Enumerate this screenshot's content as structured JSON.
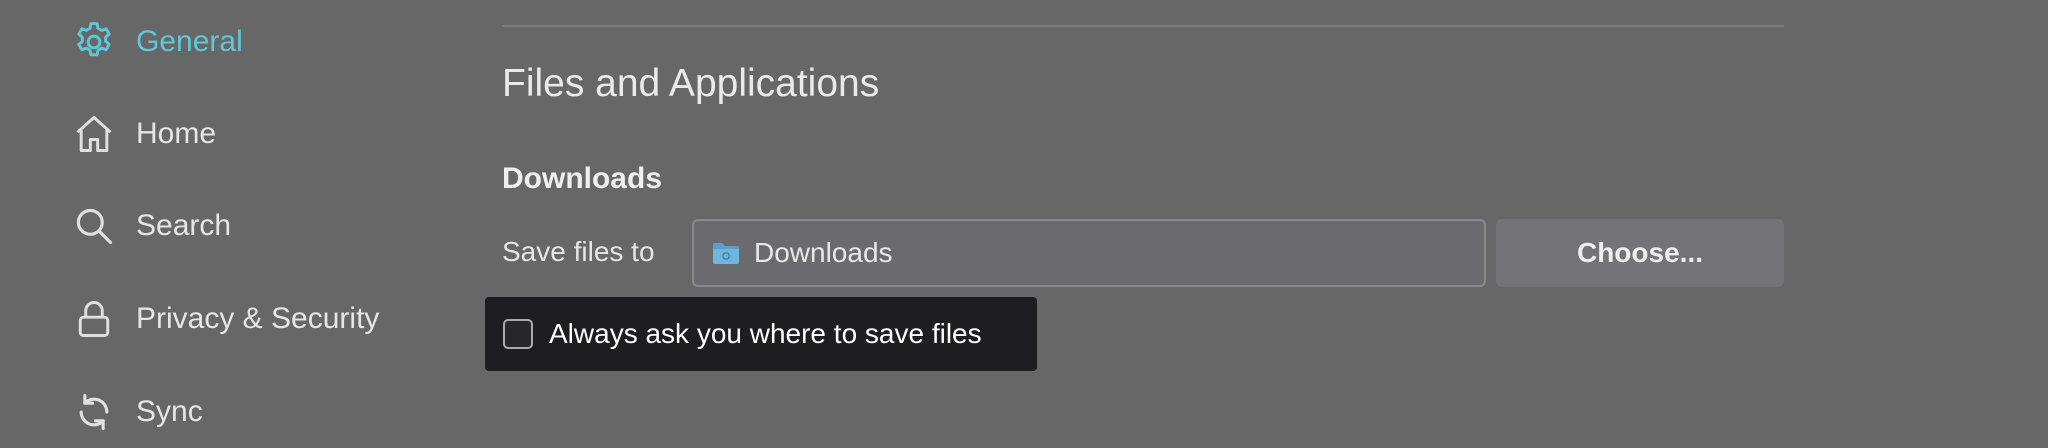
{
  "sidebar": {
    "items": [
      {
        "label": "General",
        "icon": "gear-icon",
        "active": true
      },
      {
        "label": "Home",
        "icon": "home-icon",
        "active": false
      },
      {
        "label": "Search",
        "icon": "search-icon",
        "active": false
      },
      {
        "label": "Privacy & Security",
        "icon": "lock-icon",
        "active": false
      },
      {
        "label": "Sync",
        "icon": "sync-icon",
        "active": false
      }
    ]
  },
  "main": {
    "section_title": "Files and Applications",
    "downloads": {
      "heading": "Downloads",
      "save_label": "Save files to",
      "path_value": "Downloads",
      "choose_label": "Choose...",
      "always_ask_label": "Always ask you where to save files",
      "always_ask_checked": false
    }
  },
  "colors": {
    "background": "#676767",
    "accent": "#5ec8d8",
    "tooltip_bg": "#1d1d22"
  }
}
